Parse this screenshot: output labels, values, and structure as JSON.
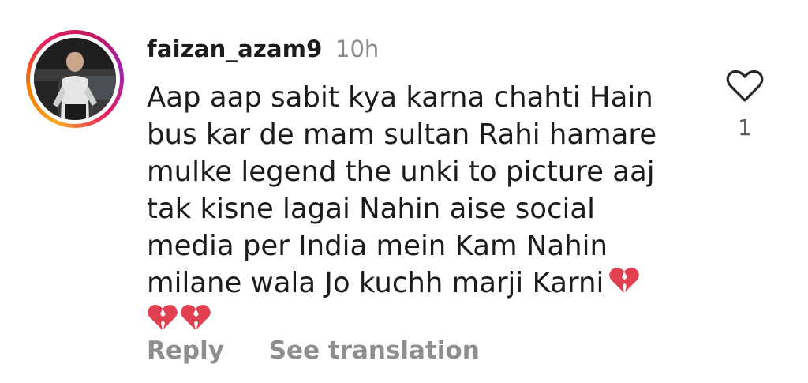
{
  "comment": {
    "username": "faizan_azam9",
    "timestamp": "10h",
    "text_lines": [
      "Aap aap sabit kya karna chahti Hain",
      "bus kar de mam sultan Rahi hamare",
      "mulke legend the unki to picture aaj",
      "tak kisne lagai Nahin aise social",
      "media per India mein Kam Nahin",
      "milane wala Jo kuchh marji Karni"
    ],
    "emoji_name": "broken-heart-emoji",
    "like_count": "1",
    "reply_label": "Reply",
    "see_translation_label": "See translation"
  },
  "icons": {
    "like": "heart-outline-icon",
    "avatar": "profile-photo"
  },
  "colors": {
    "text": "#1c1c1c",
    "muted": "#8e8e8e",
    "timestamp": "#8a8a8a",
    "broken_heart": "#e0404f"
  }
}
